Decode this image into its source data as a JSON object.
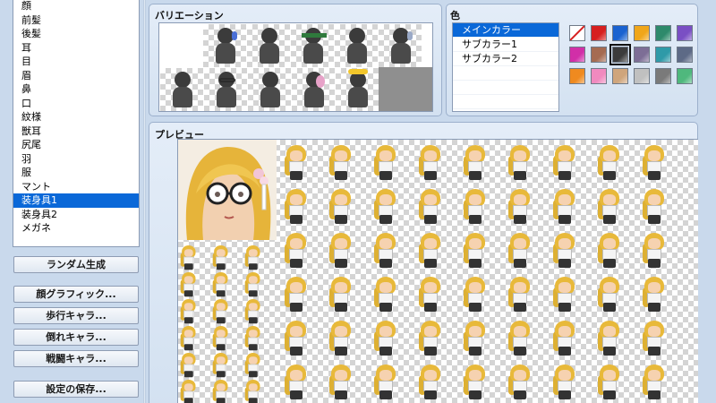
{
  "parts": {
    "items": [
      "顔",
      "前髪",
      "後髪",
      "耳",
      "目",
      "眉",
      "鼻",
      "口",
      "紋様",
      "獣耳",
      "尻尾",
      "羽",
      "服",
      "マント",
      "装身具1",
      "装身具2",
      "メガネ"
    ],
    "selected_index": 14
  },
  "buttons": {
    "random": "ランダム生成",
    "face_graphic": "顔グラフィック...",
    "walk_chara": "歩行キャラ...",
    "down_chara": "倒れキャラ...",
    "battle_chara": "戦闘キャラ...",
    "save_settings": "設定の保存..."
  },
  "variation": {
    "title": "バリエーション",
    "selected_index": 11
  },
  "color": {
    "title": "色",
    "rows": [
      "メインカラー",
      "サブカラー1",
      "サブカラー2",
      "",
      "",
      ""
    ],
    "selected_row": 0,
    "swatches": [
      "none",
      "#d61f1f",
      "#1a62d0",
      "#f0a61a",
      "#2e8a6b",
      "#7a4fc4",
      "#d12fa8",
      "#a56b52",
      "#3b3b3b",
      "#7d6e96",
      "#2f9aa8",
      "#5d6a86",
      "#ef8a1f",
      "#f08abf",
      "#cfa57c",
      "#c0c0c0",
      "#7a7a7a",
      "#4fb87d"
    ],
    "selected_swatch": 8
  },
  "preview": {
    "title": "プレビュー"
  }
}
